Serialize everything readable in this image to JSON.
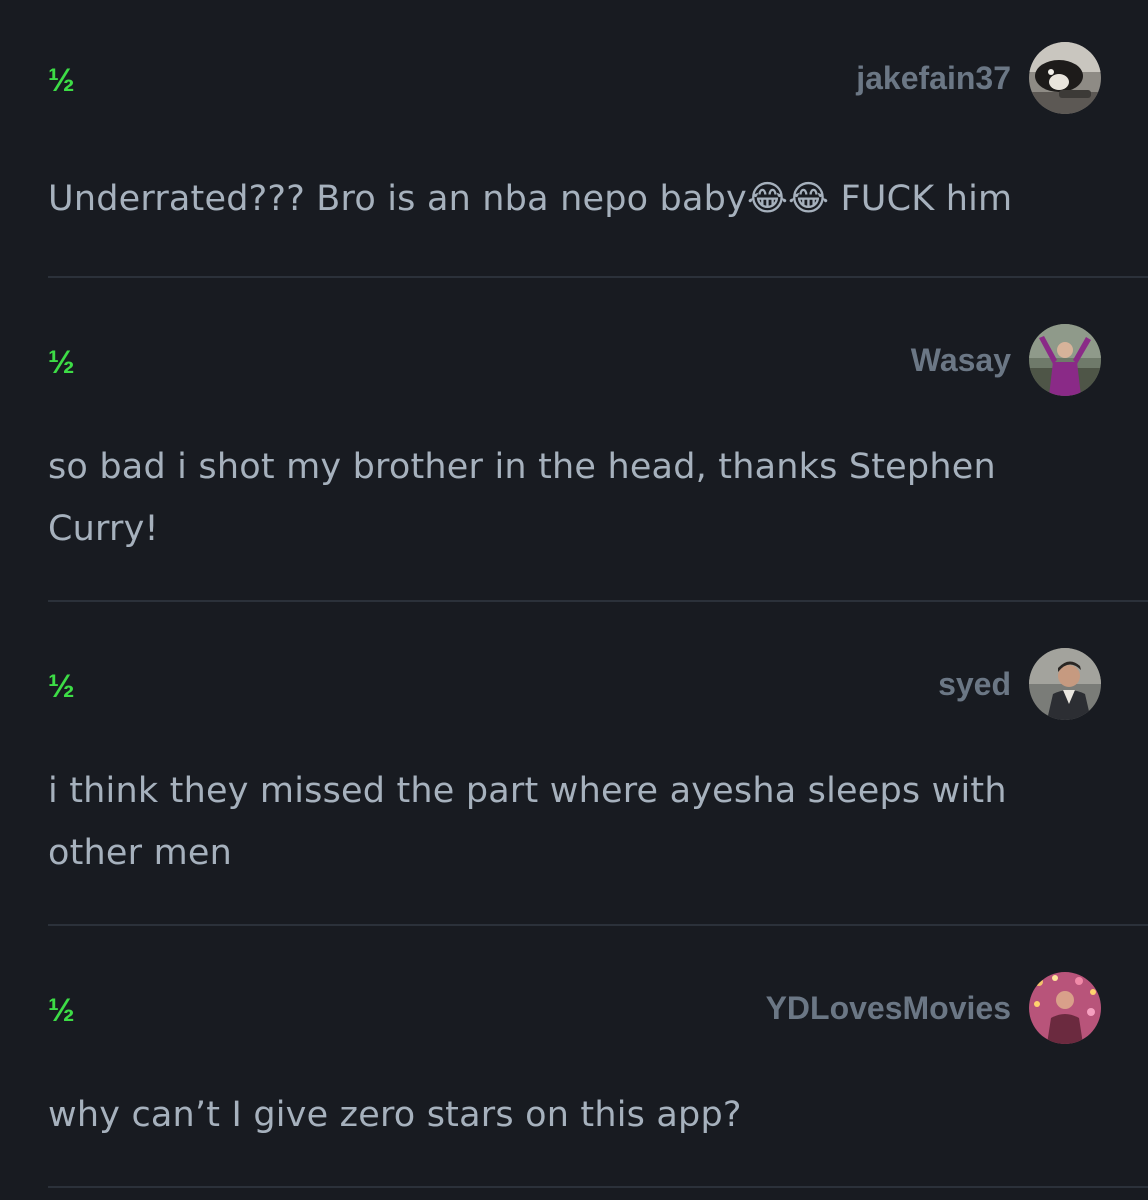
{
  "reviews": [
    {
      "rating": "½",
      "username": "jakefain37",
      "text": "Underrated??? Bro is an nba nepo baby😂😂 FUCK him"
    },
    {
      "rating": "½",
      "username": "Wasay",
      "text": "so bad i shot my brother in the head, thanks Stephen Curry!"
    },
    {
      "rating": "½",
      "username": "syed",
      "text": "i think they missed the part where ayesha sleeps with other men"
    },
    {
      "rating": "½",
      "username": "YDLovesMovies",
      "text": "why can’t I give zero stars on this app?"
    }
  ],
  "colors": {
    "background": "#181b21",
    "rating": "#3ddc46",
    "username": "#6b7785",
    "text": "#a6b1bd",
    "divider": "#2b313a"
  }
}
